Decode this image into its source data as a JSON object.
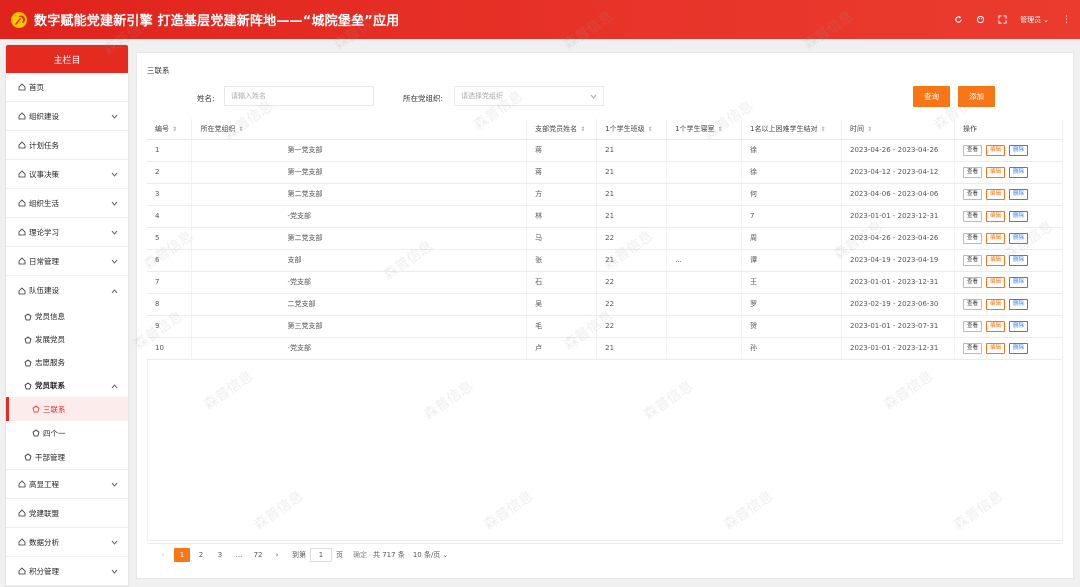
{
  "header": {
    "title": "数字赋能党建新引擎 打造基层党建新阵地——“城院堡垒”应用",
    "user": "管理员",
    "brand_color": "#e52a20"
  },
  "sidebar": {
    "title": "主栏目",
    "items": [
      {
        "label": "首页"
      },
      {
        "label": "组织建设"
      },
      {
        "label": "计划任务"
      },
      {
        "label": "议事决策"
      },
      {
        "label": "组织生活"
      },
      {
        "label": "理论学习"
      },
      {
        "label": "日常管理"
      },
      {
        "label": "队伍建设"
      }
    ],
    "sub_items": [
      {
        "label": "党员信息"
      },
      {
        "label": "发展党员"
      },
      {
        "label": "志愿服务"
      },
      {
        "label": "党员联系"
      }
    ],
    "sub_sub_items": [
      {
        "label": "三联系"
      },
      {
        "label": "四个一"
      }
    ],
    "after_items": [
      {
        "label": "干部管理"
      },
      {
        "label": "高显工程"
      },
      {
        "label": "党建联盟"
      },
      {
        "label": "数据分析"
      },
      {
        "label": "积分管理"
      }
    ]
  },
  "main": {
    "breadcrumb": "三联系",
    "filters": {
      "name_label": "姓名:",
      "name_placeholder": "请输入姓名",
      "org_label": "所在党组织:",
      "org_placeholder": "请选择党组织"
    },
    "buttons": {
      "search": "查询",
      "add": "添加"
    },
    "columns": [
      "编号",
      "所在党组织",
      "支部党员姓名",
      "1个学生班级",
      "1个学生寝室",
      "1名以上困难学生结对",
      "时间",
      "操作"
    ],
    "row_actions": {
      "view": "查看",
      "edit": "编辑",
      "delete": "删除"
    },
    "rows": [
      {
        "no": "1",
        "org": "第一党支部",
        "name": "蒋",
        "cls": "21",
        "dorm": "",
        "pair": "徐",
        "time": "2023-04-26 - 2023-04-26"
      },
      {
        "no": "2",
        "org": "第一党支部",
        "name": "蒋",
        "cls": "21",
        "dorm": "",
        "pair": "徐",
        "time": "2023-04-12 - 2023-04-12"
      },
      {
        "no": "3",
        "org": "第二党支部",
        "name": "方",
        "cls": "21",
        "dorm": "",
        "pair": "何",
        "time": "2023-04-06 - 2023-04-06"
      },
      {
        "no": "4",
        "org": "-党支部",
        "name": "林",
        "cls": "21",
        "dorm": "",
        "pair": "7",
        "time": "2023-01-01 - 2023-12-31"
      },
      {
        "no": "5",
        "org": "第二党支部",
        "name": "马",
        "cls": "22",
        "dorm": "",
        "pair": "周",
        "time": "2023-04-26 - 2023-04-26"
      },
      {
        "no": "6",
        "org": "支部",
        "name": "张",
        "cls": "21",
        "dorm": "...",
        "pair": "谭",
        "time": "2023-04-19 - 2023-04-19"
      },
      {
        "no": "7",
        "org": "-党支部",
        "name": "石",
        "cls": "22",
        "dorm": "",
        "pair": "王",
        "time": "2023-01-01 - 2023-12-31"
      },
      {
        "no": "8",
        "org": "二党支部",
        "name": "吴",
        "cls": "22",
        "dorm": "",
        "pair": "罗",
        "time": "2023-02-19 - 2023-06-30"
      },
      {
        "no": "9",
        "org": "第三党支部",
        "name": "毛",
        "cls": "22",
        "dorm": "",
        "pair": "贺",
        "time": "2023-01-01 - 2023-07-31"
      },
      {
        "no": "10",
        "org": "-党支部",
        "name": "卢",
        "cls": "21",
        "dorm": "",
        "pair": "孙",
        "time": "2023-01-01 - 2023-12-31"
      }
    ],
    "pager": {
      "pages": [
        "1",
        "2",
        "3",
        "...",
        "72"
      ],
      "goto_label": "到第",
      "goto_value": "1",
      "page_unit": "页",
      "confirm": "确定",
      "total": "共 717 条",
      "page_size": "10 条/页"
    }
  },
  "watermark_text": "森普信息"
}
